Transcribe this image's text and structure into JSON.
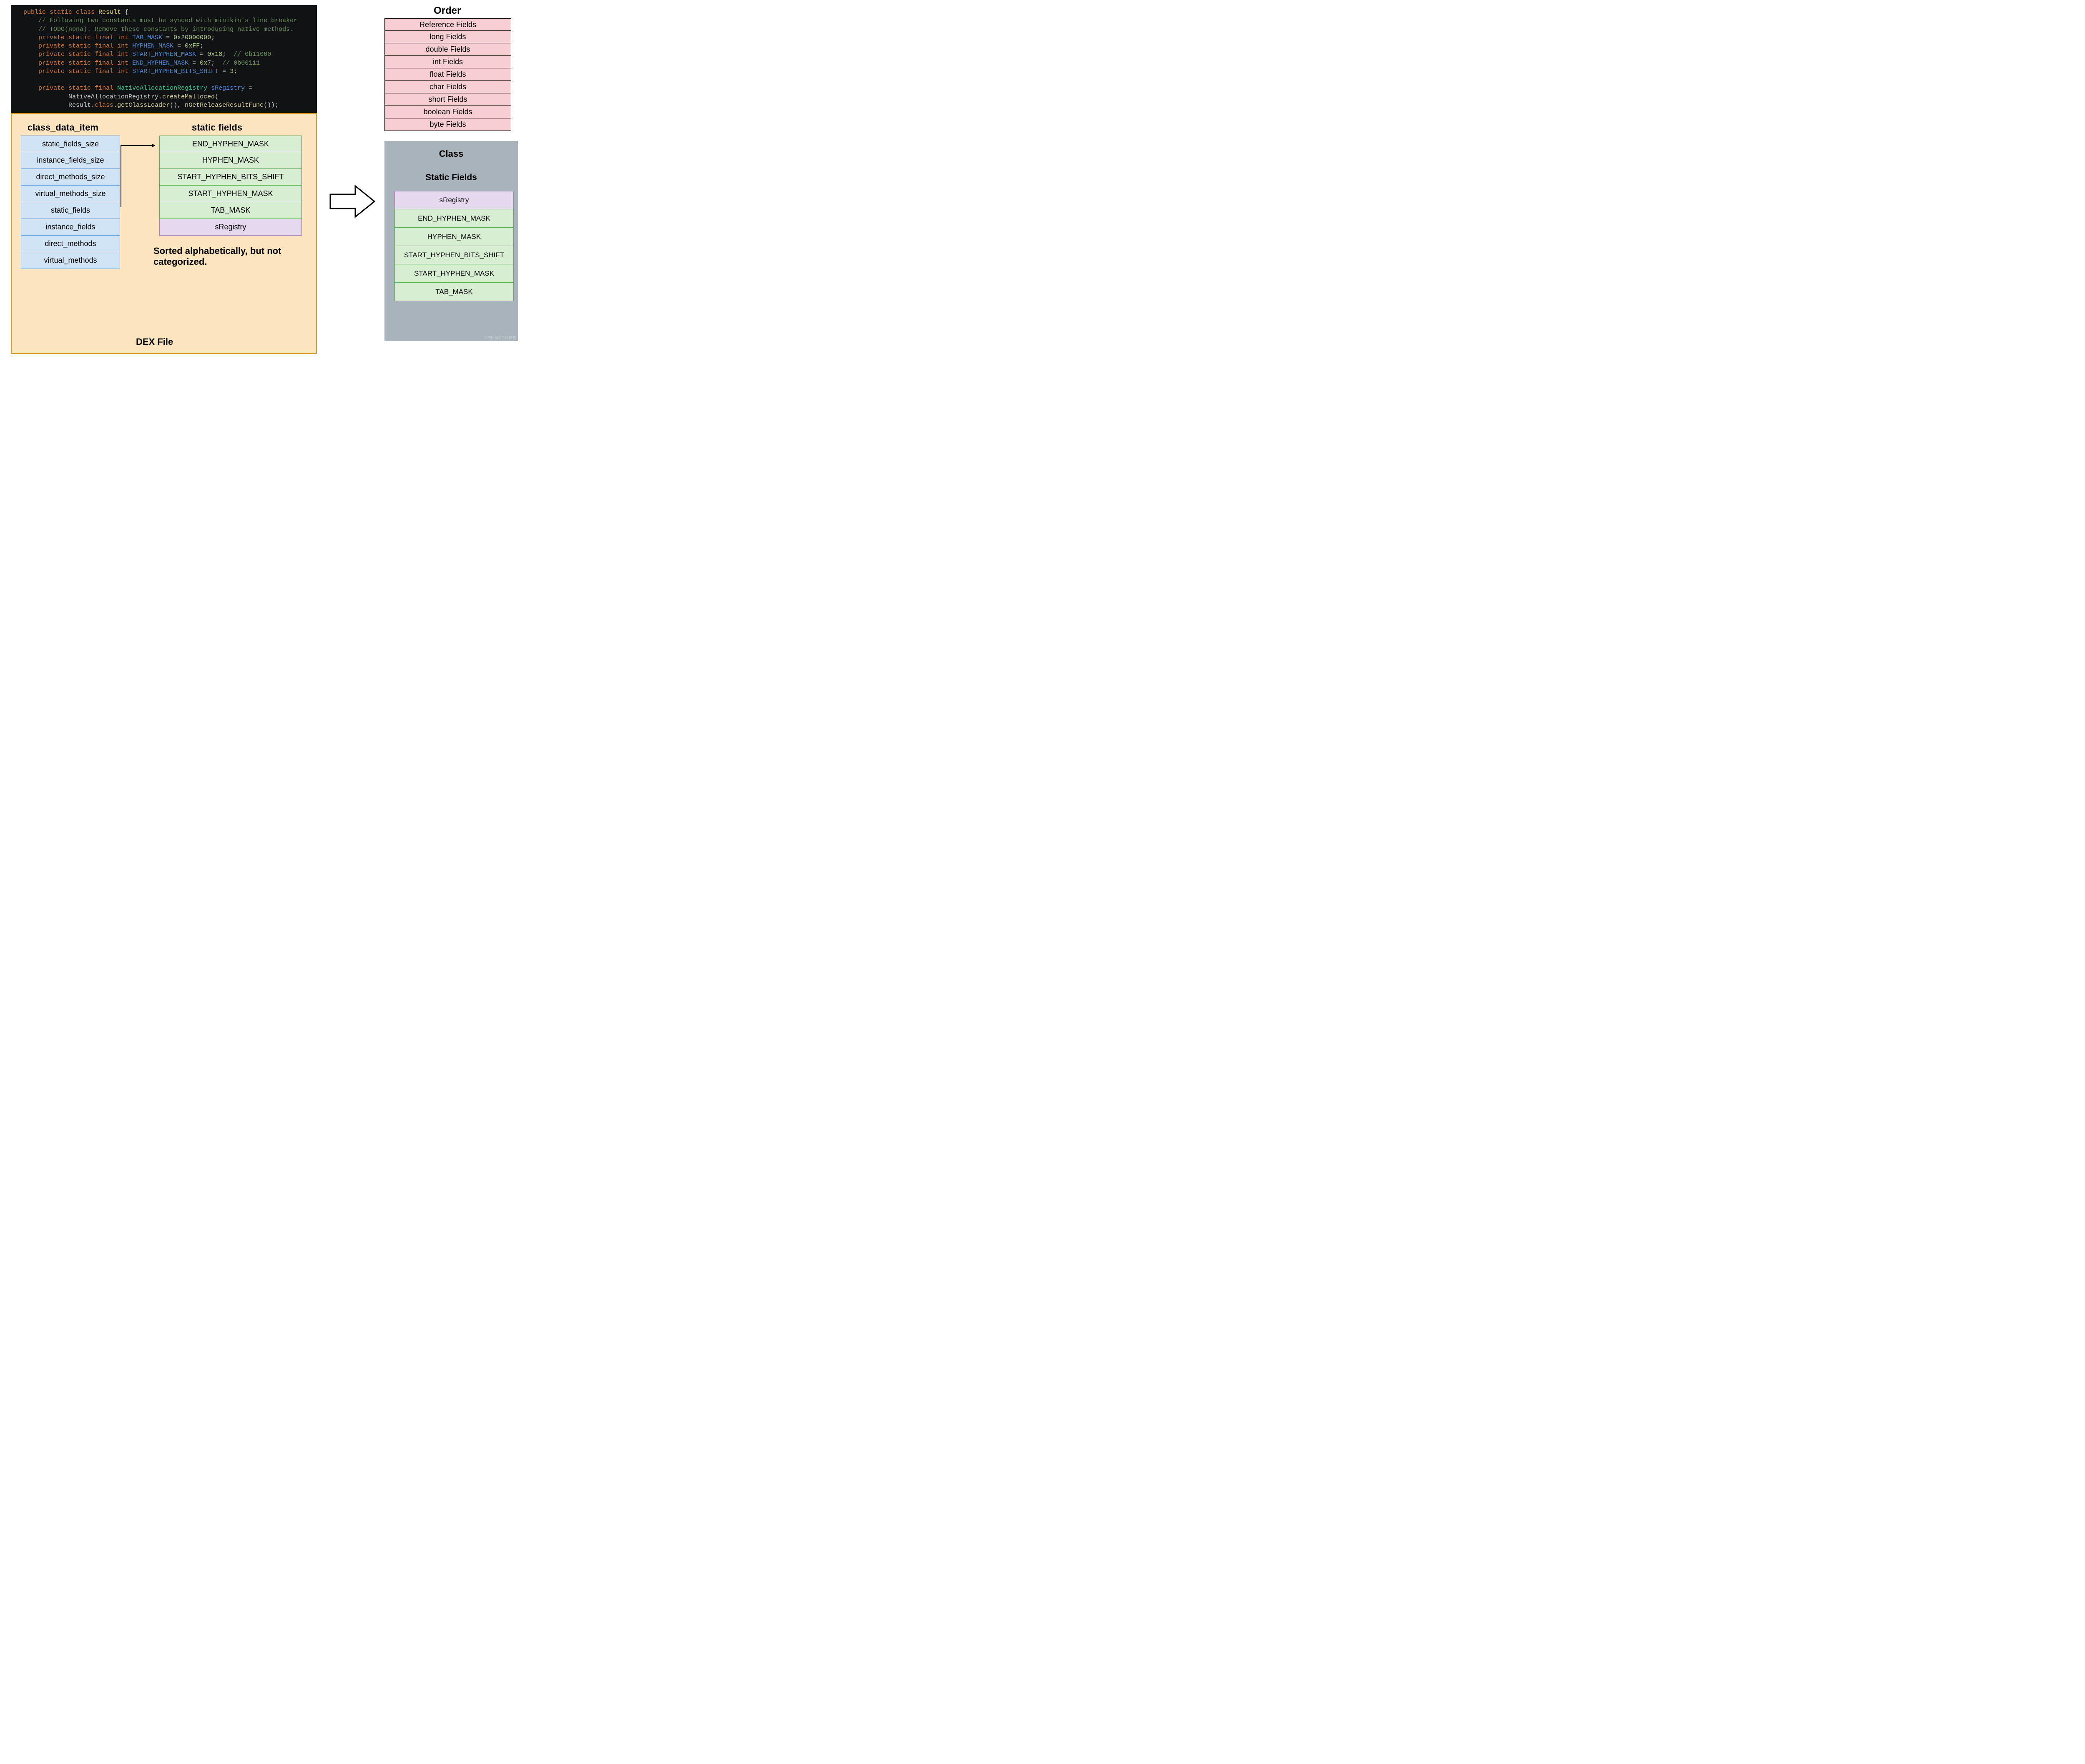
{
  "code": {
    "tokens": [
      [
        {
          "t": "public",
          "c": "kw-orange"
        },
        {
          "t": " "
        },
        {
          "t": "static",
          "c": "kw-orange"
        },
        {
          "t": " "
        },
        {
          "t": "class",
          "c": "kw-orange"
        },
        {
          "t": " "
        },
        {
          "t": "Result",
          "c": "kw-name"
        },
        {
          "t": " {",
          "c": "punct"
        }
      ],
      [
        {
          "t": "    "
        },
        {
          "t": "// Following two constants must be synced with minikin's line breaker",
          "c": "comment"
        }
      ],
      [
        {
          "t": "    "
        },
        {
          "t": "// TODO(nona): Remove these constants by introducing native methods.",
          "c": "comment"
        }
      ],
      [
        {
          "t": "    "
        },
        {
          "t": "private",
          "c": "kw-orange"
        },
        {
          "t": " "
        },
        {
          "t": "static",
          "c": "kw-orange"
        },
        {
          "t": " "
        },
        {
          "t": "final",
          "c": "kw-orange"
        },
        {
          "t": " "
        },
        {
          "t": "int",
          "c": "kw-orange"
        },
        {
          "t": " "
        },
        {
          "t": "TAB_MASK",
          "c": "kw-blue"
        },
        {
          "t": " = "
        },
        {
          "t": "0x20000000",
          "c": "num"
        },
        {
          "t": ";"
        }
      ],
      [
        {
          "t": "    "
        },
        {
          "t": "private",
          "c": "kw-orange"
        },
        {
          "t": " "
        },
        {
          "t": "static",
          "c": "kw-orange"
        },
        {
          "t": " "
        },
        {
          "t": "final",
          "c": "kw-orange"
        },
        {
          "t": " "
        },
        {
          "t": "int",
          "c": "kw-orange"
        },
        {
          "t": " "
        },
        {
          "t": "HYPHEN_MASK",
          "c": "kw-blue"
        },
        {
          "t": " = "
        },
        {
          "t": "0xFF",
          "c": "num"
        },
        {
          "t": ";"
        }
      ],
      [
        {
          "t": "    "
        },
        {
          "t": "private",
          "c": "kw-orange"
        },
        {
          "t": " "
        },
        {
          "t": "static",
          "c": "kw-orange"
        },
        {
          "t": " "
        },
        {
          "t": "final",
          "c": "kw-orange"
        },
        {
          "t": " "
        },
        {
          "t": "int",
          "c": "kw-orange"
        },
        {
          "t": " "
        },
        {
          "t": "START_HYPHEN_MASK",
          "c": "kw-blue"
        },
        {
          "t": " = "
        },
        {
          "t": "0x18",
          "c": "num"
        },
        {
          "t": ";  "
        },
        {
          "t": "// 0b11000",
          "c": "comment"
        }
      ],
      [
        {
          "t": "    "
        },
        {
          "t": "private",
          "c": "kw-orange"
        },
        {
          "t": " "
        },
        {
          "t": "static",
          "c": "kw-orange"
        },
        {
          "t": " "
        },
        {
          "t": "final",
          "c": "kw-orange"
        },
        {
          "t": " "
        },
        {
          "t": "int",
          "c": "kw-orange"
        },
        {
          "t": " "
        },
        {
          "t": "END_HYPHEN_MASK",
          "c": "kw-blue"
        },
        {
          "t": " = "
        },
        {
          "t": "0x7",
          "c": "num"
        },
        {
          "t": ";  "
        },
        {
          "t": "// 0b00111",
          "c": "comment"
        }
      ],
      [
        {
          "t": "    "
        },
        {
          "t": "private",
          "c": "kw-orange"
        },
        {
          "t": " "
        },
        {
          "t": "static",
          "c": "kw-orange"
        },
        {
          "t": " "
        },
        {
          "t": "final",
          "c": "kw-orange"
        },
        {
          "t": " "
        },
        {
          "t": "int",
          "c": "kw-orange"
        },
        {
          "t": " "
        },
        {
          "t": "START_HYPHEN_BITS_SHIFT",
          "c": "kw-blue"
        },
        {
          "t": " = "
        },
        {
          "t": "3",
          "c": "num"
        },
        {
          "t": ";"
        }
      ],
      [
        {
          "t": " "
        }
      ],
      [
        {
          "t": "    "
        },
        {
          "t": "private",
          "c": "kw-orange"
        },
        {
          "t": " "
        },
        {
          "t": "static",
          "c": "kw-orange"
        },
        {
          "t": " "
        },
        {
          "t": "final",
          "c": "kw-orange"
        },
        {
          "t": " "
        },
        {
          "t": "NativeAllocationRegistry",
          "c": "kw-green"
        },
        {
          "t": " "
        },
        {
          "t": "sRegistry",
          "c": "kw-blue"
        },
        {
          "t": " ="
        }
      ],
      [
        {
          "t": "            NativeAllocationRegistry."
        },
        {
          "t": "createMalloced",
          "c": "call"
        },
        {
          "t": "("
        }
      ],
      [
        {
          "t": "            Result."
        },
        {
          "t": "class",
          "c": "kw-orange"
        },
        {
          "t": "."
        },
        {
          "t": "getClassLoader",
          "c": "call"
        },
        {
          "t": "(), "
        },
        {
          "t": "nGetReleaseResultFunc",
          "c": "call"
        },
        {
          "t": "());"
        }
      ]
    ]
  },
  "dex": {
    "title_class_data": "class_data_item",
    "title_static_fields": "static fields",
    "class_data_items": [
      "static_fields_size",
      "instance_fields_size",
      "direct_methods_size",
      "virtual_methods_size",
      "static_fields",
      "instance_fields",
      "direct_methods",
      "virtual_methods"
    ],
    "static_fields": [
      {
        "label": "END_HYPHEN_MASK",
        "kind": "green"
      },
      {
        "label": "HYPHEN_MASK",
        "kind": "green"
      },
      {
        "label": "START_HYPHEN_BITS_SHIFT",
        "kind": "green"
      },
      {
        "label": "START_HYPHEN_MASK",
        "kind": "green"
      },
      {
        "label": "TAB_MASK",
        "kind": "green"
      },
      {
        "label": "sRegistry",
        "kind": "purple"
      }
    ],
    "caption1": "Sorted alphabetically, but not categorized.",
    "caption2": "DEX File"
  },
  "order": {
    "title": "Order",
    "items": [
      "Reference Fields",
      "long Fields",
      "double Fields",
      "int Fields",
      "float Fields",
      "char Fields",
      "short Fields",
      "boolean Fields",
      "byte Fields"
    ]
  },
  "class_box": {
    "title": "Class",
    "subtitle": "Static Fields",
    "items": [
      {
        "label": "sRegistry",
        "kind": "purple"
      },
      {
        "label": "END_HYPHEN_MASK",
        "kind": "green"
      },
      {
        "label": "HYPHEN_MASK",
        "kind": "green"
      },
      {
        "label": "START_HYPHEN_BITS_SHIFT",
        "kind": "green"
      },
      {
        "label": "START_HYPHEN_MASK",
        "kind": "green"
      },
      {
        "label": "TAB_MASK",
        "kind": "green"
      }
    ]
  },
  "watermark": "版权所有©千锋教育"
}
